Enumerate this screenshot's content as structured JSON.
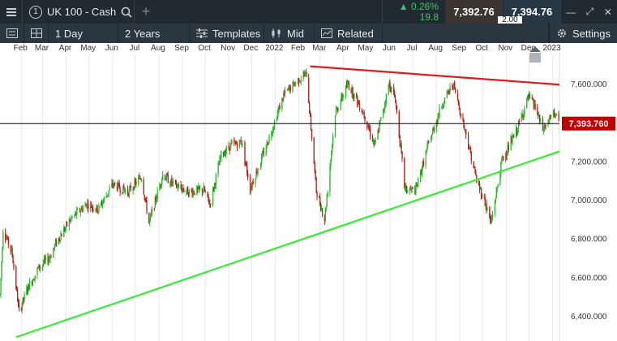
{
  "titlebar": {
    "instrument_index": "1",
    "instrument_name": "UK 100 - Cash",
    "change_pct": "0.26%",
    "change_pts": "19.8",
    "bid": "7,392.76",
    "ask": "7,394.76",
    "spread": "2.00"
  },
  "toolbar": {
    "period": "1 Day",
    "range": "2 Years",
    "templates": "Templates",
    "price_type": "Mid",
    "related": "Related",
    "settings": "Settings"
  },
  "icons": [
    "menu-icon",
    "search-icon",
    "add-tab-icon",
    "up-triangle-icon",
    "minimize-icon",
    "maximize-icon",
    "close-icon",
    "list-icon",
    "grid-icon",
    "templates-icon",
    "candles-icon",
    "chart-icon",
    "gear-icon",
    "scroll-end-icon"
  ],
  "colors": {
    "up_candle": "#2fb82f",
    "down_candle": "#b2241c",
    "resistance": "#e11b1b",
    "support": "#33ee33",
    "price_line": "#000000",
    "price_label_bg": "#c00000"
  },
  "chart_data": {
    "type": "candlestick",
    "x_axis": {
      "labels": [
        "Feb",
        "Mar",
        "Apr",
        "May",
        "Jun",
        "Jul",
        "Aug",
        "Sep",
        "Oct",
        "Nov",
        "Dec",
        "2022",
        "Feb",
        "Mar",
        "Apr",
        "May",
        "Jun",
        "Jul",
        "Aug",
        "Sep",
        "Oct",
        "Nov",
        "Dec",
        "2023"
      ],
      "range": [
        "2021-01-04",
        "2023-01-10"
      ]
    },
    "y_axis": {
      "labels": [
        "7,600.000",
        "7,400.000",
        "7,200.000",
        "7,000.000",
        "6,800.000",
        "6,600.000",
        "6,400.000"
      ],
      "ticks": [
        7600,
        7400,
        7200,
        7000,
        6800,
        6600,
        6400
      ],
      "range": [
        6270,
        7810
      ]
    },
    "current_price_label": "7,393.760",
    "current_price": 7393.76,
    "grid": "vertical only",
    "legend": "none",
    "series_path": [
      [
        "2021-01-04",
        6510
      ],
      [
        "2021-01-08",
        6850
      ],
      [
        "2021-01-20",
        6720
      ],
      [
        "2021-01-29",
        6420
      ],
      [
        "2021-02-09",
        6540
      ],
      [
        "2021-02-24",
        6650
      ],
      [
        "2021-03-10",
        6700
      ],
      [
        "2021-03-19",
        6780
      ],
      [
        "2021-04-07",
        6900
      ],
      [
        "2021-04-28",
        6980
      ],
      [
        "2021-05-13",
        6950
      ],
      [
        "2021-06-01",
        7080
      ],
      [
        "2021-06-21",
        7040
      ],
      [
        "2021-07-09",
        7120
      ],
      [
        "2021-07-19",
        6880
      ],
      [
        "2021-08-06",
        7130
      ],
      [
        "2021-08-20",
        7080
      ],
      [
        "2021-09-09",
        7040
      ],
      [
        "2021-09-29",
        7050
      ],
      [
        "2021-10-07",
        6980
      ],
      [
        "2021-10-22",
        7230
      ],
      [
        "2021-11-03",
        7280
      ],
      [
        "2021-11-18",
        7300
      ],
      [
        "2021-11-29",
        7060
      ],
      [
        "2021-12-13",
        7200
      ],
      [
        "2021-12-31",
        7400
      ],
      [
        "2022-01-12",
        7540
      ],
      [
        "2022-01-31",
        7620
      ],
      [
        "2022-02-11",
        7650
      ],
      [
        "2022-02-24",
        7050
      ],
      [
        "2022-03-07",
        6900
      ],
      [
        "2022-03-21",
        7450
      ],
      [
        "2022-04-07",
        7600
      ],
      [
        "2022-04-27",
        7450
      ],
      [
        "2022-05-12",
        7280
      ],
      [
        "2022-05-31",
        7600
      ],
      [
        "2022-06-08",
        7520
      ],
      [
        "2022-06-21",
        7050
      ],
      [
        "2022-07-05",
        7050
      ],
      [
        "2022-07-21",
        7280
      ],
      [
        "2022-08-08",
        7490
      ],
      [
        "2022-08-23",
        7600
      ],
      [
        "2022-09-09",
        7340
      ],
      [
        "2022-09-23",
        7100
      ],
      [
        "2022-10-03",
        7000
      ],
      [
        "2022-10-12",
        6880
      ],
      [
        "2022-10-26",
        7200
      ],
      [
        "2022-11-14",
        7350
      ],
      [
        "2022-11-30",
        7530
      ],
      [
        "2022-12-09",
        7480
      ],
      [
        "2022-12-19",
        7360
      ],
      [
        "2023-01-04",
        7454
      ],
      [
        "2023-01-09",
        7394
      ]
    ],
    "trendlines": [
      {
        "name": "resistance",
        "from": [
          "2022-02-16",
          7690
        ],
        "to": [
          "2023-01-10",
          7595
        ]
      },
      {
        "name": "support",
        "from": [
          "2021-01-25",
          6290
        ],
        "to": [
          "2023-01-10",
          7250
        ]
      }
    ]
  }
}
